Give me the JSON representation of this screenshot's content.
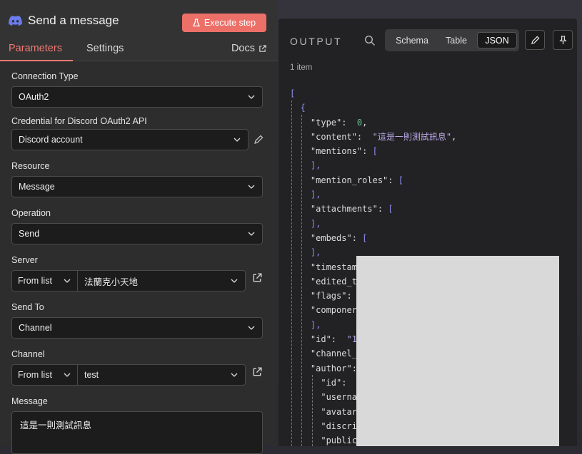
{
  "node": {
    "title": "Send a message",
    "execute_label": "Execute step",
    "tabs": [
      "Parameters",
      "Settings"
    ],
    "docs_label": "Docs"
  },
  "form": {
    "connection_type": {
      "label": "Connection Type",
      "value": "OAuth2"
    },
    "credential": {
      "label": "Credential for Discord OAuth2 API",
      "value": "Discord account"
    },
    "resource": {
      "label": "Resource",
      "value": "Message"
    },
    "operation": {
      "label": "Operation",
      "value": "Send"
    },
    "server": {
      "label": "Server",
      "mode": "From list",
      "value": "法蘭克小天地"
    },
    "send_to": {
      "label": "Send To",
      "value": "Channel"
    },
    "channel": {
      "label": "Channel",
      "mode": "From list",
      "value": "test"
    },
    "message": {
      "label": "Message",
      "value": "這是一則測試訊息"
    }
  },
  "output": {
    "title": "OUTPUT",
    "views": [
      "Schema",
      "Table",
      "JSON"
    ],
    "active_view": "JSON",
    "item_count": "1 item",
    "json_lines": [
      {
        "t": "[",
        "cls": "br"
      },
      {
        "t": "  {",
        "cls": "br"
      },
      {
        "t": "    \"type\":  ",
        "v": "0",
        "vc": "num",
        "tail": ","
      },
      {
        "t": "    \"content\":  ",
        "v": "\"這是一則測試訊息\"",
        "vc": "str",
        "tail": ","
      },
      {
        "t": "    \"mentions\": ",
        "v": "[",
        "vc": "br"
      },
      {
        "t": "    ",
        "v": "],",
        "vc": "br"
      },
      {
        "t": "    \"mention_roles\": ",
        "v": "[",
        "vc": "br"
      },
      {
        "t": "    ",
        "v": "],",
        "vc": "br"
      },
      {
        "t": "    \"attachments\": ",
        "v": "[",
        "vc": "br"
      },
      {
        "t": "    ",
        "v": "],",
        "vc": "br"
      },
      {
        "t": "    \"embeds\": ",
        "v": "[",
        "vc": "br"
      },
      {
        "t": "    ",
        "v": "],",
        "vc": "br"
      },
      {
        "t": "    \"timestam"
      },
      {
        "t": "    \"edited_t"
      },
      {
        "t": "    \"flags\": "
      },
      {
        "t": "    \"componer"
      },
      {
        "t": "    ",
        "v": "],",
        "vc": "br"
      },
      {
        "t": "    \"id\":  ",
        "v": "\"1",
        "vc": "str"
      },
      {
        "t": "    \"channel_"
      },
      {
        "t": "    \"author\":"
      },
      {
        "t": "      \"id\":  "
      },
      {
        "t": "      \"userna"
      },
      {
        "t": "      \"avatar"
      },
      {
        "t": "      \"discri"
      },
      {
        "t": "      \"public"
      }
    ]
  }
}
